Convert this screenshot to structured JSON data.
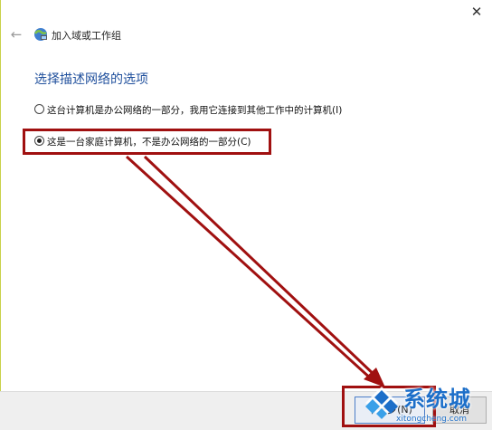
{
  "window": {
    "close_glyph": "✕"
  },
  "header": {
    "back_icon": "back-arrow-icon",
    "wizard_icon": "network-globe-icon",
    "title": "加入域或工作组"
  },
  "main": {
    "section_title": "选择描述网络的选项",
    "options": [
      {
        "label": "这台计算机是办公网络的一部分，我用它连接到其他工作中的计算机(I)",
        "checked": false
      },
      {
        "label": "这是一台家庭计算机，不是办公网络的一部分(C)",
        "checked": true
      }
    ]
  },
  "footer": {
    "next_label": "下一步(N)",
    "cancel_label": "取消"
  },
  "watermark": {
    "text": "系统城",
    "url": "xitongcheng.com"
  },
  "colors": {
    "annotation_red": "#a01010",
    "title_blue": "#1f4f9c",
    "watermark_blue": "#1d6fc9"
  }
}
